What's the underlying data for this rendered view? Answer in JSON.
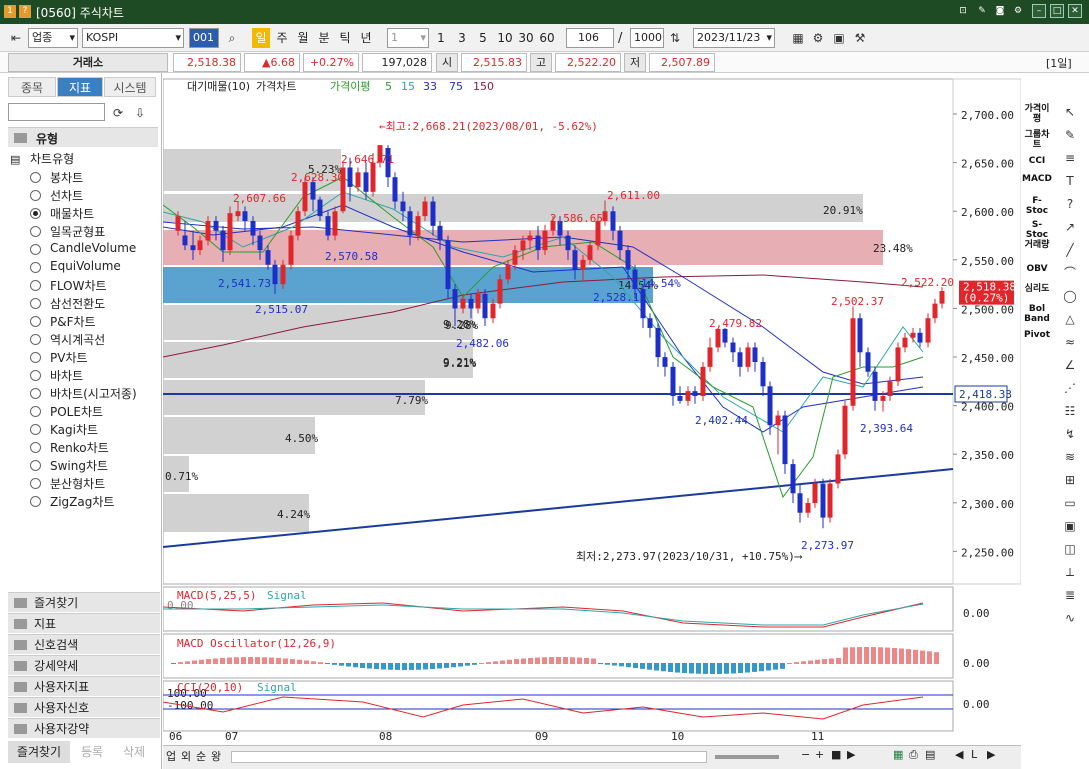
{
  "window": {
    "title": "[0560] 주식차트"
  },
  "toolbar": {
    "market": "업종",
    "index": "KOSPI",
    "code_button": "001",
    "timeframes": [
      "일",
      "주",
      "월",
      "분",
      "틱",
      "년"
    ],
    "period_value": "1",
    "quick_periods": [
      "1",
      "3",
      "5",
      "10",
      "30",
      "60"
    ],
    "count": "106",
    "total": "1000",
    "date": "2023/11/23"
  },
  "quote": {
    "exchange": "거래소",
    "price": "2,518.38",
    "change": "▲6.68",
    "change_pct": "+0.27%",
    "volume": "197,028",
    "open_label": "시",
    "open": "2,515.83",
    "high_label": "고",
    "high": "2,522.20",
    "low_label": "저",
    "low": "2,507.89",
    "period_badge": "[1일]"
  },
  "left": {
    "tabs": [
      "종목",
      "지표",
      "시스템"
    ],
    "section_type": "유형",
    "chart_type_label": "차트유형",
    "chart_types": [
      "봉차트",
      "선차트",
      "매물차트",
      "일목균형표",
      "CandleVolume",
      "EquiVolume",
      "FLOW차트",
      "삼선전환도",
      "P&F차트",
      "역시계곡선",
      "PV차트",
      "바차트",
      "바차트(시고저종)",
      "POLE차트",
      "Kagi차트",
      "Renko차트",
      "Swing차트",
      "분산형차트",
      "ZigZag차트"
    ],
    "selected_index": 2,
    "accordion": [
      "즐겨찾기",
      "지표",
      "신호검색",
      "강세약세",
      "사용자지표",
      "사용자신호",
      "사용자강약"
    ],
    "bottom_tabs": [
      "즐겨찾기",
      "등록",
      "삭제"
    ]
  },
  "legend": {
    "items": [
      "대기매물(10)",
      "가격차트",
      "가격이평",
      "5",
      "15",
      "33",
      "75",
      "150"
    ]
  },
  "annotations": {
    "high": "←최고:2,668.21(2023/08/01, -5.62%)",
    "low": "최저:2,273.97(2023/10/31, +10.75%)⟶",
    "labels": [
      "2,607.66",
      "2,628.30",
      "2,646.71",
      "5.23%",
      "2,570.58",
      "2,541.73",
      "2,515.07",
      "2,586.65",
      "2,611.00",
      "9.28%",
      "2,482.06",
      "2,528.1",
      "14.54%",
      "9.21%",
      "2,479.82",
      "2,402.44",
      "2,502.37",
      "2,522.20",
      "2,393.64",
      "2,273.97"
    ]
  },
  "volume_profile": {
    "pct": [
      "20.91%",
      "23.48%",
      "14.54%",
      "9.28%",
      "9.21%",
      "7.79%",
      "4.50%",
      "0.71%",
      "4.24%"
    ]
  },
  "price_axis": {
    "ticks": [
      "2,700.00",
      "2,650.00",
      "2,600.00",
      "2,550.00",
      "2,500.00",
      "2,450.00",
      "2,400.00",
      "2,350.00",
      "2,300.00",
      "2,250.00"
    ],
    "current": "2,518.38",
    "current_pct": "(0.27%)",
    "hline": "2,418.33"
  },
  "indicators": [
    {
      "name": "MACD(5,25,5)",
      "signal": "Signal",
      "left": "0.00",
      "axis": "0.00"
    },
    {
      "name": "MACD Oscillator(12,26,9)",
      "axis": "0.00"
    },
    {
      "name": "CCI(20,10)",
      "signal": "Signal",
      "left_top": "100.00",
      "left_bot": "-100.00",
      "axis": "0.00"
    }
  ],
  "x_axis": {
    "labels": [
      "06",
      "07",
      "08",
      "09",
      "10",
      "11"
    ]
  },
  "right_tools": [
    "가격이평",
    "그룹차트",
    "CCI",
    "MACD",
    "F-Stoc",
    "S-Stoc",
    "거래량",
    "OBV",
    "심리도",
    "Bol Band",
    "Pivot"
  ],
  "bottom_bar": {
    "buttons": [
      "업",
      "외",
      "순",
      "왕"
    ]
  },
  "colors": {
    "up": "#e0262b",
    "down": "#1e2fc8",
    "titlebar": "#1f4b24",
    "accent": "#3b7fc0"
  }
}
